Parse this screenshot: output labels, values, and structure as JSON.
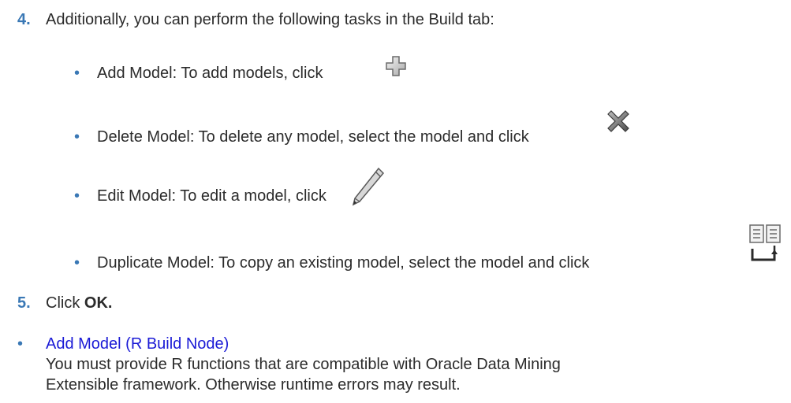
{
  "steps": [
    {
      "number": "4.",
      "text": "Additionally, you can perform the following tasks in the Build tab:"
    },
    {
      "number": "5.",
      "text_prefix": "Click ",
      "bold": "OK."
    }
  ],
  "subtasks": [
    {
      "text": "Add Model: To add models, click",
      "icon": "add-plus-icon"
    },
    {
      "text": "Delete Model: To delete any model, select the model and click",
      "icon": "delete-x-icon"
    },
    {
      "text": "Edit Model: To edit a model, click",
      "icon": "edit-pencil-icon"
    },
    {
      "text": "Duplicate Model: To copy an existing model, select the model and click",
      "icon": "duplicate-model-icon"
    }
  ],
  "related": {
    "link": "Add Model (R Build Node)",
    "description_line1": "You must provide R functions that are compatible with Oracle Data Mining",
    "description_line2": "Extensible framework. Otherwise runtime errors may result."
  },
  "colors": {
    "accent": "#3a78b5",
    "link": "#1a1ad6",
    "text": "#2b2b2b"
  }
}
